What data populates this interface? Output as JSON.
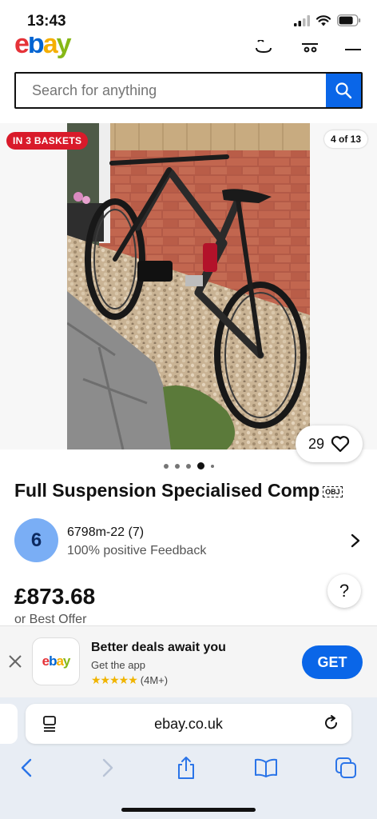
{
  "status": {
    "time": "13:43"
  },
  "header": {
    "logo_letters": [
      "e",
      "b",
      "a",
      "y"
    ]
  },
  "search": {
    "placeholder": "Search for anything"
  },
  "gallery": {
    "baskets_badge": "IN 3 BASKETS",
    "counter": "4 of 13",
    "watch_count": "29",
    "dots_total": 5,
    "active_dot": 4
  },
  "listing": {
    "title": "Full Suspension Specialised Comp",
    "obj_tag": "OBJ",
    "price": "£873.68",
    "best_offer": "or Best Offer"
  },
  "seller": {
    "avatar_letter": "6",
    "name": "6798m-22 (7)",
    "feedback": "100% positive Feedback"
  },
  "help": {
    "label": "?"
  },
  "app_banner": {
    "logo_letters": [
      "e",
      "b",
      "a",
      "y"
    ],
    "title": "Better deals await you",
    "subtitle": "Get the app",
    "stars": "★★★★★",
    "rating_count": "(4M+)",
    "button": "GET"
  },
  "safari": {
    "url": "ebay.co.uk"
  },
  "icons": [
    "signal-icon",
    "wifi-icon",
    "battery-icon",
    "search-icon",
    "heart-icon",
    "chevron-right-icon",
    "close-icon",
    "reader-icon",
    "reload-icon",
    "back-icon",
    "forward-icon",
    "share-icon",
    "bookmarks-icon",
    "tabs-icon"
  ],
  "colors": {
    "accent_blue": "#0a66e8",
    "badge_red": "#d91a2a",
    "avatar_blue": "#7aaef5",
    "star_gold": "#f0b400",
    "ebay_red": "#e53238",
    "ebay_blue": "#0064d2",
    "ebay_yellow": "#f5af02",
    "ebay_green": "#86b817"
  }
}
